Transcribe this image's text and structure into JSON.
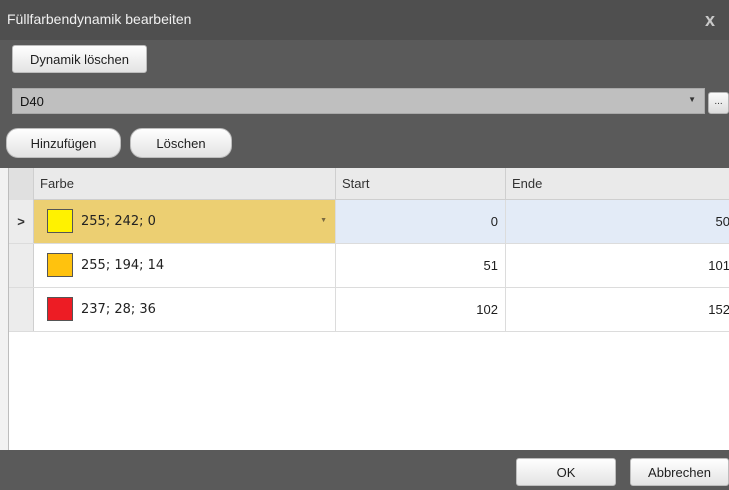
{
  "window": {
    "title": "Füllfarbendynamik bearbeiten",
    "close_glyph": "x"
  },
  "toolbar": {
    "delete_dynamic_label": "Dynamik löschen",
    "variable_value": "D40",
    "ellipsis_label": "...",
    "add_label": "Hinzufügen",
    "remove_label": "Löschen"
  },
  "grid": {
    "columns": [
      "Farbe",
      "Start",
      "Ende"
    ],
    "rows": [
      {
        "color_text": "255; 242; 0",
        "swatch": "#fff200",
        "start": "0",
        "end": "50",
        "selected": true
      },
      {
        "color_text": "255; 194; 14",
        "swatch": "#ffc20e",
        "start": "51",
        "end": "101",
        "selected": false
      },
      {
        "color_text": "237; 28; 36",
        "swatch": "#ed1c24",
        "start": "102",
        "end": "152",
        "selected": false
      }
    ],
    "row_indicator": ">"
  },
  "footer": {
    "ok_label": "OK",
    "cancel_label": "Abbrechen"
  },
  "colors": {
    "titlebar": "#4f4f4f",
    "panel": "#5a5a5a",
    "selected_color_cell": "#eccf72",
    "selected_row": "#e3ebf7"
  }
}
